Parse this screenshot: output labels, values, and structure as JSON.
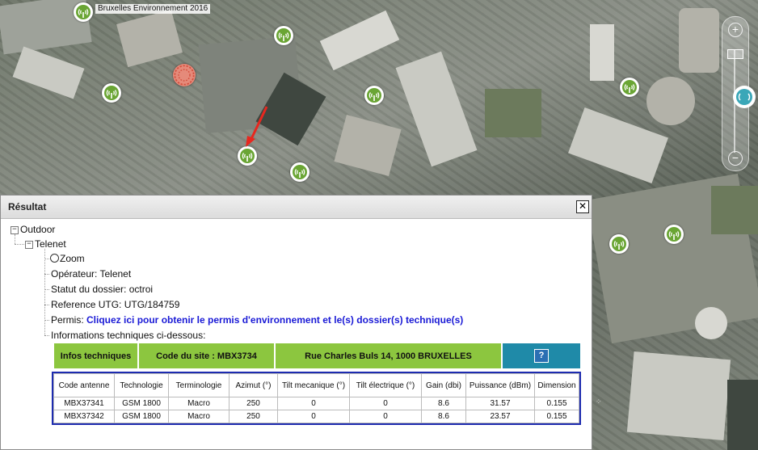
{
  "map": {
    "title": "Bruxelles Environnement 2016",
    "zoom_in_label": "+",
    "zoom_out_label": "−",
    "marker_icon": "antenna-icon",
    "arrow_color": "#e8271f"
  },
  "panel": {
    "title": "Résultat",
    "close_label": "✕"
  },
  "tree": {
    "outdoor": "Outdoor",
    "operator_group": "Telenet",
    "zoom_label": "Zoom",
    "operateur": "Opérateur: Telenet",
    "statut": "Statut du dossier: octroi",
    "reference": "Reference UTG: UTG/184759",
    "permis_label": "Permis:",
    "permis_link": "Cliquez ici pour obtenir le permis d'environnement et le(s) dossier(s) technique(s)",
    "info_tech_line": "Informations techniques ci-dessous:"
  },
  "info_bar": {
    "infos": "Infos techniques",
    "code_site": "Code du site : MBX3734",
    "address": "Rue Charles Buls 14, 1000 BRUXELLES",
    "help": "?"
  },
  "tech_table": {
    "headers": [
      "Code antenne",
      "Technologie",
      "Terminologie",
      "Azimut (°)",
      "Tilt mecanique (°)",
      "Tilt électrique (°)",
      "Gain (dbi)",
      "Puissance (dBm)",
      "Dimension"
    ],
    "rows": [
      [
        "MBX37341",
        "GSM 1800",
        "Macro",
        "250",
        "0",
        "0",
        "8.6",
        "31.57",
        "0.155"
      ],
      [
        "MBX37342",
        "GSM 1800",
        "Macro",
        "250",
        "0",
        "0",
        "8.6",
        "23.57",
        "0.155"
      ]
    ]
  },
  "colors": {
    "info_green": "#8cc63f",
    "help_teal": "#1f8aa8",
    "table_border": "#1e2cb0",
    "link_blue": "#1a1ad6"
  }
}
